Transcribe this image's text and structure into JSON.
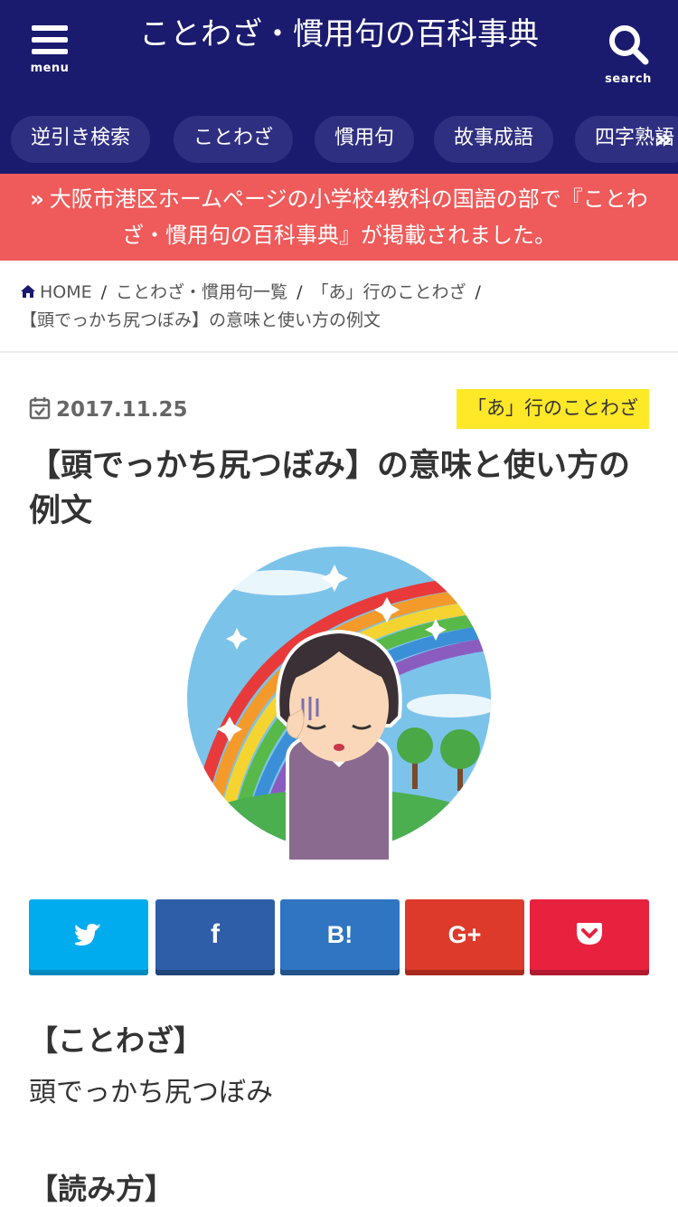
{
  "header": {
    "menu_label": "menu",
    "site_title": "ことわざ・慣用句の百科事典",
    "search_label": "search",
    "bg_color": "#1a1a6e"
  },
  "nav": {
    "items": [
      "逆引き検索",
      "ことわざ",
      "慣用句",
      "故事成語",
      "四字熟語"
    ],
    "more_arrow": "»"
  },
  "notice": {
    "mark": "»",
    "text": "大阪市港区ホームページの小学校4教科の国語の部で『ことわざ・慣用句の百科事典』が掲載されました。",
    "bg_color": "#ef5a5a"
  },
  "breadcrumb": {
    "items": [
      "HOME",
      "ことわざ・慣用句一覧",
      "「あ」行のことわざ",
      "【頭でっかち尻つぼみ】の意味と使い方の例文"
    ],
    "separator": "/"
  },
  "article": {
    "date": "2017.11.25",
    "category": "「あ」行のことわざ",
    "title": "【頭でっかち尻つぼみ】の意味と使い方の例文"
  },
  "share": [
    {
      "name": "twitter",
      "glyph": "🐦",
      "color": "#00aced",
      "shadow": "#0089bd"
    },
    {
      "name": "facebook",
      "glyph": "f",
      "color": "#2e5ea8",
      "shadow": "#1f4478"
    },
    {
      "name": "hatena",
      "glyph": "B!",
      "color": "#2f75c2",
      "shadow": "#21528a"
    },
    {
      "name": "googleplus",
      "glyph": "G+",
      "color": "#dd3a2b",
      "shadow": "#a82a1f"
    },
    {
      "name": "pocket",
      "glyph": "pocket",
      "color": "#e8213f",
      "shadow": "#b0192f"
    }
  ],
  "sections": [
    {
      "heading": "【ことわざ】",
      "body": "頭でっかち尻つぼみ"
    },
    {
      "heading": "【読み方】",
      "body": ""
    }
  ]
}
